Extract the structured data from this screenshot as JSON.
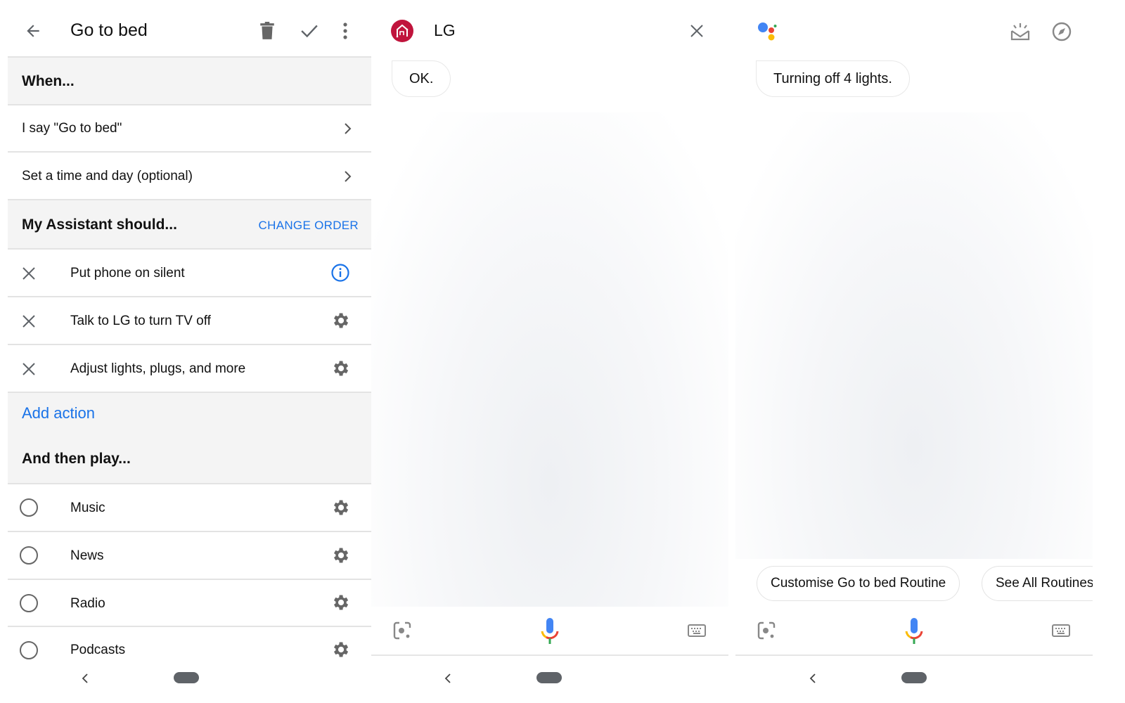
{
  "routine_editor": {
    "title": "Go to bed",
    "icons": {
      "back": "arrow-left-icon",
      "delete": "trash-icon",
      "save": "check-icon",
      "more": "more-vert-icon"
    },
    "when_label": "When...",
    "triggers": [
      {
        "label": "I say \"Go to bed\"",
        "icon": "chevron-right-icon"
      },
      {
        "label": "Set a time and day (optional)",
        "icon": "chevron-right-icon"
      }
    ],
    "assistant_label": "My Assistant should...",
    "change_order": "CHANGE ORDER",
    "actions": [
      {
        "label": "Put phone on silent",
        "trailing_icon": "info-icon"
      },
      {
        "label": "Talk to LG to turn TV off",
        "trailing_icon": "gear-icon"
      },
      {
        "label": "Adjust lights, plugs, and more",
        "trailing_icon": "gear-icon"
      }
    ],
    "add_action": "Add action",
    "then_play_label": "And then play...",
    "media": [
      {
        "label": "Music",
        "selected": false
      },
      {
        "label": "News",
        "selected": false
      },
      {
        "label": "Radio",
        "selected": false
      },
      {
        "label": "Podcasts",
        "selected": false
      }
    ]
  },
  "lg_conversation": {
    "title": "LG",
    "response": "OK."
  },
  "assistant_conversation": {
    "response": "Turning off 4 lights.",
    "suggestions": [
      "Customise Go to bed Routine",
      "See All Routines"
    ]
  },
  "colors": {
    "accent_blue": "#1a73e8",
    "lg_red": "#c0143c",
    "google_blue": "#4285f4",
    "google_red": "#ea4335",
    "google_yellow": "#fbbc05",
    "google_green": "#34a853"
  }
}
